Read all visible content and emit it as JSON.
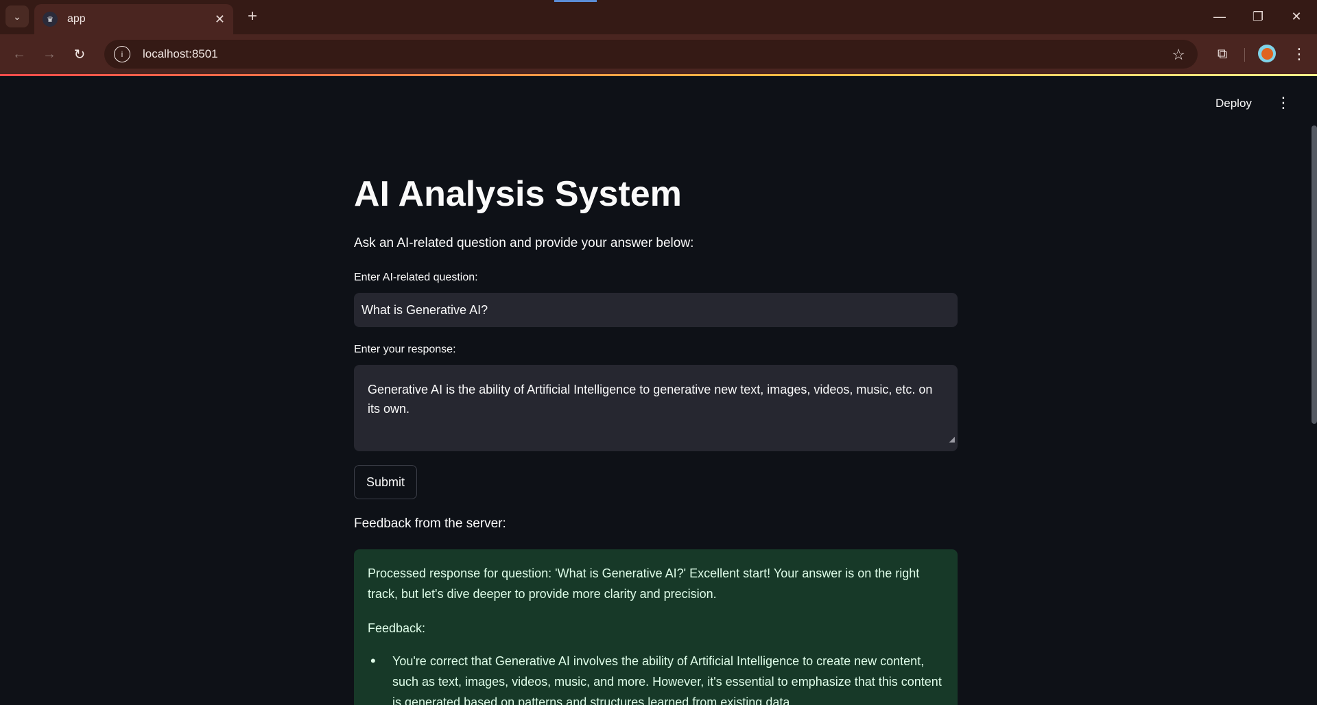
{
  "browser": {
    "tab_title": "app",
    "url": "localhost:8501"
  },
  "header": {
    "deploy_label": "Deploy"
  },
  "main": {
    "title": "AI Analysis System",
    "intro": "Ask an AI-related question and provide your answer below:",
    "question_label": "Enter AI-related question:",
    "question_value": "What is Generative AI?",
    "response_label": "Enter your response:",
    "response_value": "Generative AI is the ability of Artificial Intelligence to generative new text, images, videos, music, etc. on its own.",
    "submit_label": "Submit",
    "feedback_heading": "Feedback from the server:",
    "feedback": {
      "paragraph": "Processed response for question: 'What is Generative AI?' Excellent start! Your answer is on the right track, but let's dive deeper to provide more clarity and precision.",
      "label": "Feedback:",
      "items": [
        "You're correct that Generative AI involves the ability of Artificial Intelligence to create new content, such as text, images, videos, music, and more. However, it's essential to emphasize that this content is generated based on patterns and structures learned from existing data."
      ]
    }
  },
  "colors": {
    "background": "#0e1117",
    "input_bg": "#262730",
    "feedback_bg": "#173928",
    "feedback_text": "#dffde9"
  }
}
